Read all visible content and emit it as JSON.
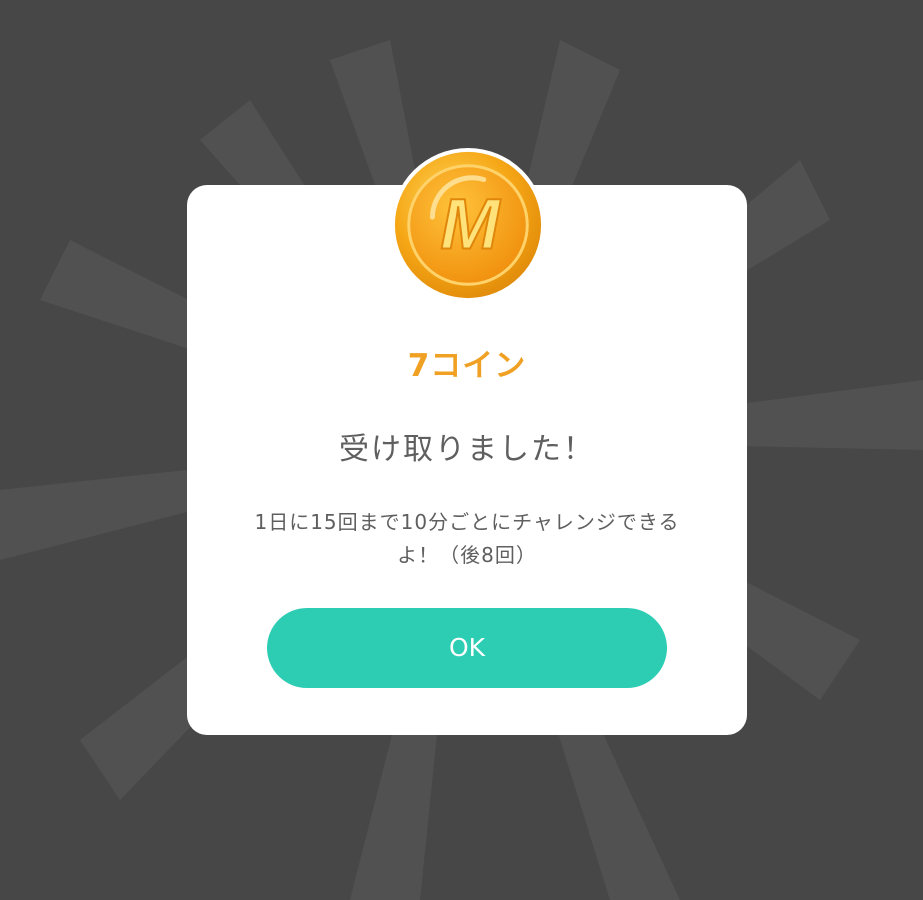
{
  "dialog": {
    "coin_icon": "coin-m-icon",
    "coin_letter": "M",
    "amount": "7コイン",
    "headline": "受け取りました！",
    "note_line1": "1日に15回まで10分ごとにチャレンジできる",
    "note_line2": "よ！（後8回）",
    "ok_label": "OK"
  },
  "colors": {
    "backdrop": "#474747",
    "accent_orange": "#f0a023",
    "button_teal": "#2dcdb3",
    "text_gray": "#5f5f5f"
  }
}
